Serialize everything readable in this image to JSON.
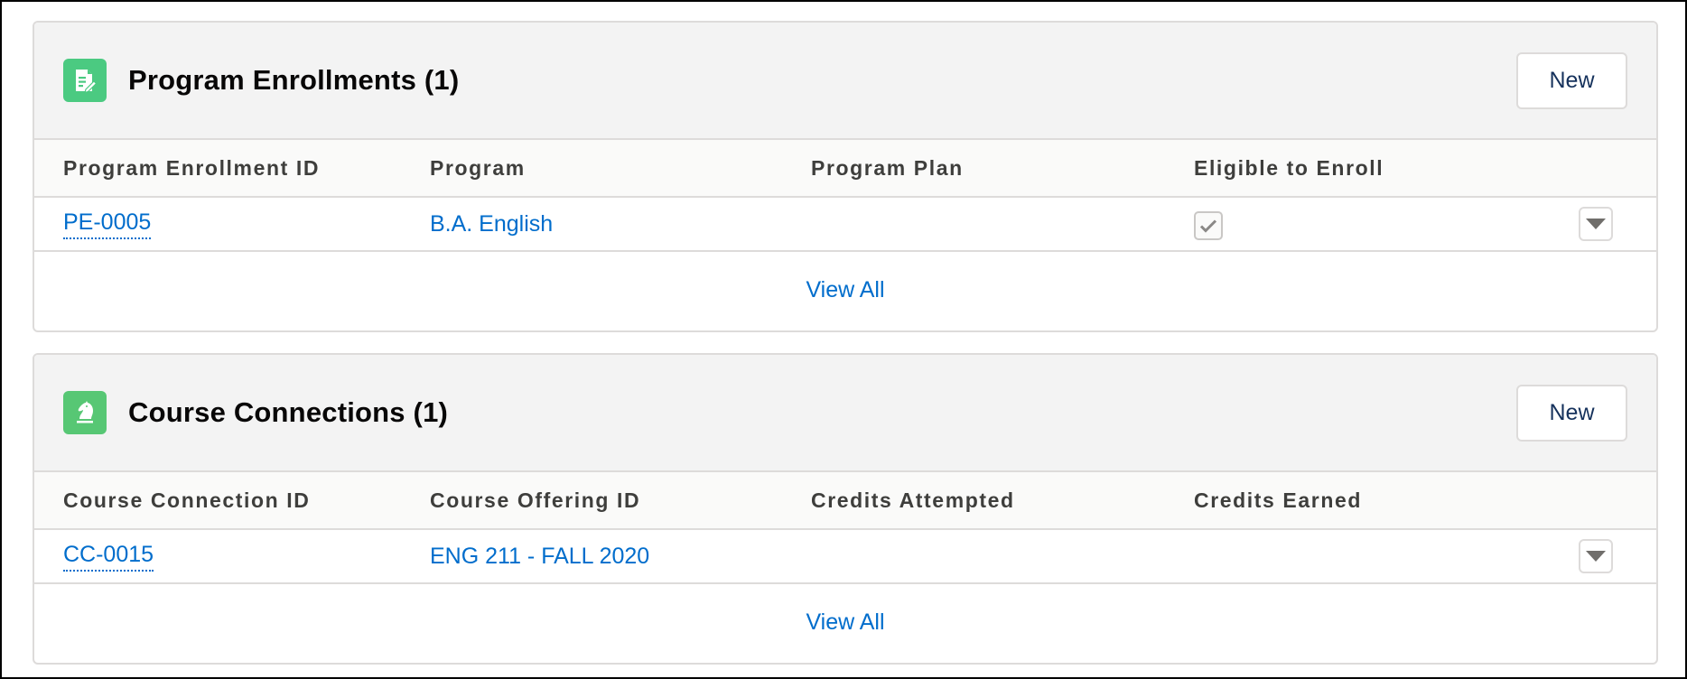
{
  "colors": {
    "link": "#006dcc",
    "header_bg": "#f3f3f3",
    "icon_green": "#4bca81",
    "border": "#dddbda"
  },
  "program_enrollments": {
    "icon": "program-enrollment-icon",
    "title": "Program Enrollments (1)",
    "new_label": "New",
    "columns": [
      "Program Enrollment ID",
      "Program",
      "Program Plan",
      "Eligible to Enroll"
    ],
    "rows": [
      {
        "id": "PE-0005",
        "program": "B.A. English",
        "program_plan": "",
        "eligible_to_enroll": true
      }
    ],
    "view_all": "View All"
  },
  "course_connections": {
    "icon": "knight-icon",
    "title": "Course Connections (1)",
    "new_label": "New",
    "columns": [
      "Course Connection ID",
      "Course Offering ID",
      "Credits Attempted",
      "Credits Earned"
    ],
    "rows": [
      {
        "id": "CC-0015",
        "course_offering": "ENG 211 - FALL 2020",
        "credits_attempted": "",
        "credits_earned": ""
      }
    ],
    "view_all": "View All"
  }
}
